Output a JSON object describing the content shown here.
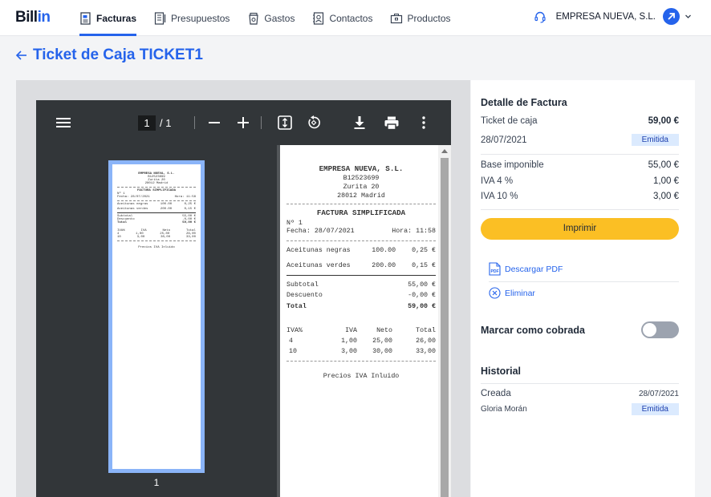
{
  "brand": {
    "logo_main": "Bill",
    "logo_accent": "in"
  },
  "nav": {
    "items": [
      {
        "label": "Facturas",
        "icon": "invoice-icon",
        "active": true
      },
      {
        "label": "Presupuestos",
        "icon": "budget-icon"
      },
      {
        "label": "Gastos",
        "icon": "coffee-cup-icon"
      },
      {
        "label": "Contactos",
        "icon": "contact-icon"
      },
      {
        "label": "Productos",
        "icon": "box-icon"
      }
    ]
  },
  "header": {
    "company": "EMPRESA NUEVA, S.L.",
    "accent": "#2563eb"
  },
  "page": {
    "title": "Ticket de Caja TICKET1"
  },
  "viewer": {
    "current_page": "1",
    "total_pages": "/ 1",
    "thumb_label": "1"
  },
  "ticket": {
    "company": "EMPRESA NUEVA, S.L.",
    "cif": "B12523699",
    "address": "Zurita 20",
    "city": "28012 Madrid",
    "doc_title": "FACTURA SIMPLIFICADA",
    "number": "Nº 1",
    "date": "Fecha: 28/07/2021",
    "time": "Hora: 11:58",
    "items": [
      {
        "name": "Aceitunas negras",
        "qty": "100.00",
        "price": "0,25 €"
      },
      {
        "name": "Aceitunas verdes",
        "qty": "200.00",
        "price": "0,15 €"
      }
    ],
    "subtotal_label": "Subtotal",
    "subtotal": "55,00 €",
    "discount_label": "Descuento",
    "discount": "-0,00 €",
    "total_label": "Total",
    "total": "59,00 €",
    "tax_headers": [
      "IVA%",
      "IVA",
      "Neto",
      "Total"
    ],
    "tax_rows": [
      [
        "4",
        "1,00",
        "25,00",
        "26,00"
      ],
      [
        "10",
        "3,00",
        "30,00",
        "33,00"
      ]
    ],
    "footer": "Precios IVA Inluido"
  },
  "panel": {
    "detail_title": "Detalle de Factura",
    "type_label": "Ticket de caja",
    "amount": "59,00 €",
    "date": "28/07/2021",
    "status": "Emitida",
    "base_label": "Base imponible",
    "base": "55,00 €",
    "iva4_label": "IVA 4 %",
    "iva4": "1,00 €",
    "iva10_label": "IVA 10 %",
    "iva10": "3,00 €",
    "print_label": "Imprimir",
    "download_label": "Descargar PDF",
    "delete_label": "Eliminar",
    "paid_label": "Marcar como cobrada",
    "history_title": "Historial",
    "history_event": "Creada",
    "history_date": "28/07/2021",
    "history_user": "Gloria Morán",
    "history_status": "Emitida"
  }
}
